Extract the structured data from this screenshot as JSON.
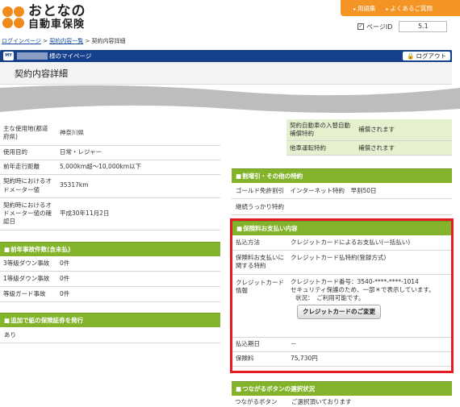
{
  "header": {
    "brand_line1": "おとなの",
    "brand_line2": "自動車保険",
    "links": [
      "用語集",
      "よくあるご質問"
    ],
    "page_id_label": "ページID",
    "page_id_value": "5.1"
  },
  "breadcrumb": {
    "items": [
      "ログインページ",
      "契約内容一覧",
      "契約内容詳細"
    ],
    "separator": ">"
  },
  "mypage": {
    "badge": "MY",
    "suffix": "様のマイページ",
    "logout": "ログアウト"
  },
  "page_title": "契約内容詳細",
  "left": {
    "usage_rows": [
      {
        "k": "主な使用地(都道府県)",
        "v": "神奈川県"
      },
      {
        "k": "使用目的",
        "v": "日常・レジャー"
      },
      {
        "k": "前年走行距離",
        "v": "5,000km超～10,000km以下"
      },
      {
        "k": "契約時におけるオドメーター値",
        "v": "35317km"
      },
      {
        "k": "契約時におけるオドメーター値の確認日",
        "v": "平成30年11月2日"
      }
    ],
    "accidents_title": "前年事故件数(含未払)",
    "accidents_rows": [
      {
        "k": "3等級ダウン事故",
        "v": "0件"
      },
      {
        "k": "1等級ダウン事故",
        "v": "0件"
      },
      {
        "k": "等級ガード事故",
        "v": "0件"
      }
    ],
    "cert_title": "追加で紙の保険証券を発行",
    "cert_value": "あり"
  },
  "right": {
    "top_rows": [
      {
        "k": "契約自動車の入替自動補償特約",
        "v": "補償されます"
      },
      {
        "k": "他車運転特約",
        "v": "補償されます"
      }
    ],
    "discount_title": "割増引・その他の特約",
    "discount_rows": [
      "ゴールド免許割引　インターネット特約　早割50日",
      "継続うっかり特約"
    ],
    "payment_title": "保険料お支払い内容",
    "payment_rows": [
      {
        "k": "払込方法",
        "v": "クレジットカードによるお支払い(一括払い)"
      },
      {
        "k": "保険料お支払いに関する特約",
        "v": "クレジットカード払特約(登録方式)"
      }
    ],
    "card": {
      "k": "クレジットカード情報",
      "number": "クレジットカード番号：3540-****-****-1014",
      "note": "セキュリティ保護のため、一部＊で表示しています。",
      "status": "状況：　ご利用可能です。",
      "button": "クレジットカードのご変更"
    },
    "due_row": {
      "k": "払込期日",
      "v": "－"
    },
    "premium_row": {
      "k": "保険料",
      "v": "75,730円"
    },
    "connect_title": "つながるボタンの選択状況",
    "connect_row": {
      "k": "つながるボタン",
      "v": "ご選択頂いております"
    }
  },
  "colors": {
    "accent_orange": "#f39424",
    "navy": "#163f8c",
    "section_green": "#82b32b",
    "highlight_red": "#e41b23"
  }
}
